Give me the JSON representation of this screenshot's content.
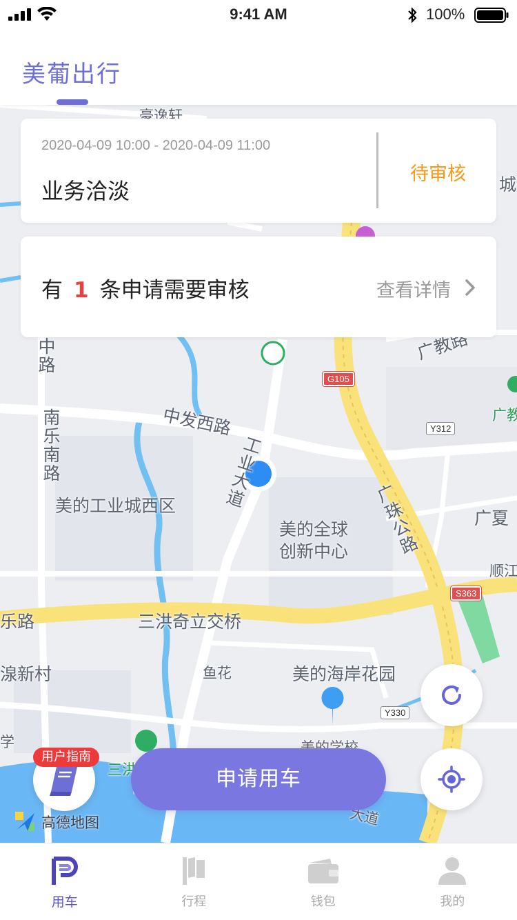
{
  "status_bar": {
    "time": "9:41 AM",
    "battery": "100%",
    "icons": [
      "signal-icon",
      "wifi-icon",
      "bluetooth-icon",
      "battery-icon"
    ]
  },
  "header": {
    "title": "美葡出行",
    "accent_color": "#6e6fd6"
  },
  "trip_card": {
    "time_range": "2020-04-09 10:00 - 2020-04-09 11:00",
    "purpose": "业务洽淡",
    "status": "待审核",
    "status_color": "#f39a1b"
  },
  "notice_card": {
    "prefix": "有",
    "count": "1",
    "suffix": "条申请需要审核",
    "detail_label": "查看详情"
  },
  "map": {
    "labels": [
      "豪逸轩",
      "乐中路",
      "南乐南路",
      "中发西路",
      "工业大道",
      "美的工业城西区",
      "美的全球",
      "创新中心",
      "广珠公路",
      "广教路",
      "广教",
      "广夏",
      "顺江",
      "乐路",
      "三洪奇立交桥",
      "鱼花",
      "美的海岸花园",
      "湶新村",
      "美的学校",
      "学",
      "三洪",
      "城",
      "大道"
    ],
    "shields": [
      "G105",
      "Y312",
      "S363",
      "Y330"
    ],
    "amap_brand": "高德地图"
  },
  "buttons": {
    "apply": "申请用车",
    "guide_badge": "用户指南"
  },
  "tabs": [
    {
      "label": "用车",
      "icon": "car-p-icon",
      "active": true
    },
    {
      "label": "行程",
      "icon": "flag-icon",
      "active": false
    },
    {
      "label": "钱包",
      "icon": "wallet-icon",
      "active": false
    },
    {
      "label": "我的",
      "icon": "person-icon",
      "active": false
    }
  ]
}
